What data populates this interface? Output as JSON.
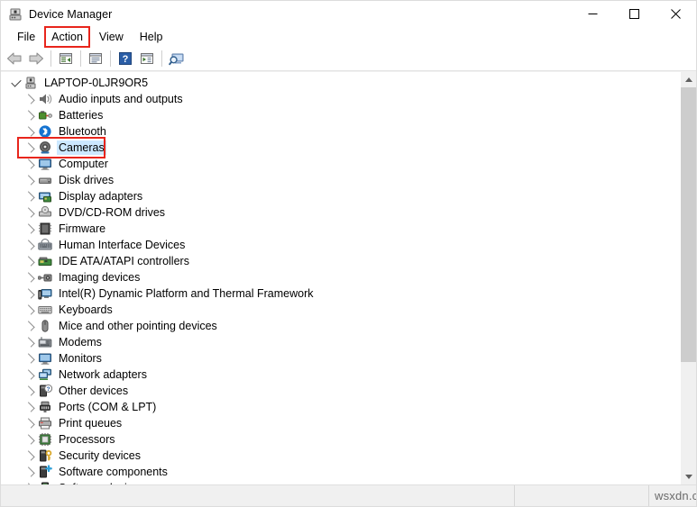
{
  "window": {
    "title": "Device Manager",
    "title_icon": "device-manager-icon",
    "controls": {
      "minimize": "minimize-icon",
      "maximize": "maximize-icon",
      "close": "close-icon"
    }
  },
  "menubar": {
    "items": [
      {
        "label": "File",
        "highlighted": false
      },
      {
        "label": "Action",
        "highlighted": true
      },
      {
        "label": "View",
        "highlighted": false
      },
      {
        "label": "Help",
        "highlighted": false
      }
    ]
  },
  "toolbar": {
    "buttons": [
      {
        "name": "back-arrow-icon",
        "sep_after": false
      },
      {
        "name": "forward-arrow-icon",
        "sep_after": true
      },
      {
        "name": "properties-icon",
        "sep_after": true
      },
      {
        "name": "update-driver-icon",
        "sep_after": true
      },
      {
        "name": "help-icon",
        "sep_after": false
      },
      {
        "name": "show-hidden-devices-icon",
        "sep_after": true
      },
      {
        "name": "scan-for-hardware-changes-icon",
        "sep_after": false
      }
    ]
  },
  "tree": {
    "root": {
      "label": "LAPTOP-0LJR9OR5",
      "icon": "computer-root-icon",
      "expanded": true
    },
    "items": [
      {
        "label": "Audio inputs and outputs",
        "icon": "speaker-icon",
        "selected": false,
        "boxed": false
      },
      {
        "label": "Batteries",
        "icon": "battery-icon",
        "selected": false,
        "boxed": false
      },
      {
        "label": "Bluetooth",
        "icon": "bluetooth-icon",
        "selected": false,
        "boxed": false
      },
      {
        "label": "Cameras",
        "icon": "camera-icon",
        "selected": true,
        "boxed": true
      },
      {
        "label": "Computer",
        "icon": "monitor-icon",
        "selected": false,
        "boxed": false
      },
      {
        "label": "Disk drives",
        "icon": "disk-drive-icon",
        "selected": false,
        "boxed": false
      },
      {
        "label": "Display adapters",
        "icon": "display-adapter-icon",
        "selected": false,
        "boxed": false
      },
      {
        "label": "DVD/CD-ROM drives",
        "icon": "dvd-drive-icon",
        "selected": false,
        "boxed": false
      },
      {
        "label": "Firmware",
        "icon": "firmware-chip-icon",
        "selected": false,
        "boxed": false
      },
      {
        "label": "Human Interface Devices",
        "icon": "hid-icon",
        "selected": false,
        "boxed": false
      },
      {
        "label": "IDE ATA/ATAPI controllers",
        "icon": "ide-controller-icon",
        "selected": false,
        "boxed": false
      },
      {
        "label": "Imaging devices",
        "icon": "imaging-device-icon",
        "selected": false,
        "boxed": false
      },
      {
        "label": "Intel(R) Dynamic Platform and Thermal Framework",
        "icon": "thermal-framework-icon",
        "selected": false,
        "boxed": false
      },
      {
        "label": "Keyboards",
        "icon": "keyboard-icon",
        "selected": false,
        "boxed": false
      },
      {
        "label": "Mice and other pointing devices",
        "icon": "mouse-icon",
        "selected": false,
        "boxed": false
      },
      {
        "label": "Modems",
        "icon": "modem-icon",
        "selected": false,
        "boxed": false
      },
      {
        "label": "Monitors",
        "icon": "monitor-icon",
        "selected": false,
        "boxed": false
      },
      {
        "label": "Network adapters",
        "icon": "network-adapter-icon",
        "selected": false,
        "boxed": false
      },
      {
        "label": "Other devices",
        "icon": "other-device-icon",
        "selected": false,
        "boxed": false
      },
      {
        "label": "Ports (COM & LPT)",
        "icon": "port-icon",
        "selected": false,
        "boxed": false
      },
      {
        "label": "Print queues",
        "icon": "printer-icon",
        "selected": false,
        "boxed": false
      },
      {
        "label": "Processors",
        "icon": "processor-icon",
        "selected": false,
        "boxed": false
      },
      {
        "label": "Security devices",
        "icon": "security-device-icon",
        "selected": false,
        "boxed": false
      },
      {
        "label": "Software components",
        "icon": "software-component-icon",
        "selected": false,
        "boxed": false
      },
      {
        "label": "Software devices",
        "icon": "software-device-icon",
        "selected": false,
        "boxed": false
      }
    ]
  },
  "scrollbar": {
    "up_arrow": "scroll-up-icon",
    "down_arrow": "scroll-down-icon"
  },
  "statusbar": {
    "pane1": "",
    "pane2": "",
    "watermark": "wsxdn.com"
  },
  "colors": {
    "highlight_box": "#e8251c",
    "selection": "#cce8ff",
    "chrome": "#f0f0f0"
  }
}
